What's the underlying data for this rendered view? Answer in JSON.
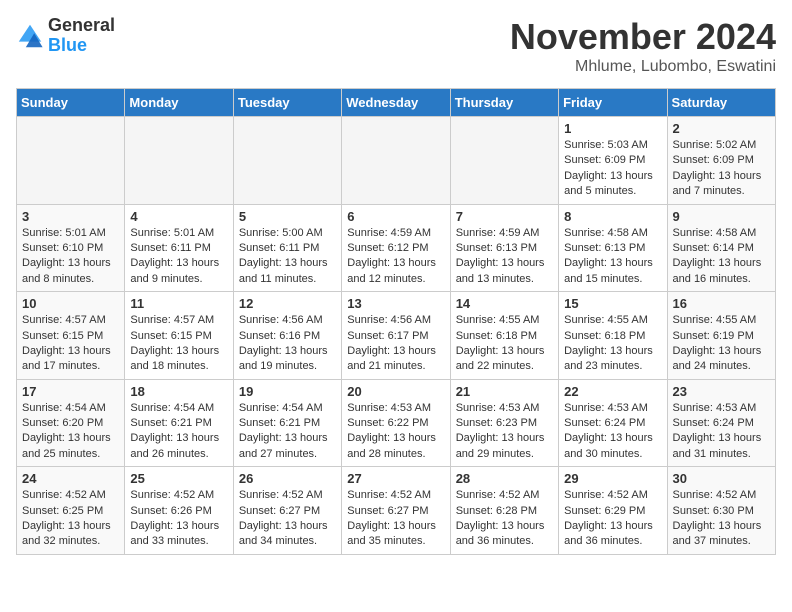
{
  "logo": {
    "general": "General",
    "blue": "Blue"
  },
  "title": "November 2024",
  "location": "Mhlume, Lubombo, Eswatini",
  "days_header": [
    "Sunday",
    "Monday",
    "Tuesday",
    "Wednesday",
    "Thursday",
    "Friday",
    "Saturday"
  ],
  "weeks": [
    [
      {
        "day": "",
        "info": ""
      },
      {
        "day": "",
        "info": ""
      },
      {
        "day": "",
        "info": ""
      },
      {
        "day": "",
        "info": ""
      },
      {
        "day": "",
        "info": ""
      },
      {
        "day": "1",
        "info": "Sunrise: 5:03 AM\nSunset: 6:09 PM\nDaylight: 13 hours\nand 5 minutes."
      },
      {
        "day": "2",
        "info": "Sunrise: 5:02 AM\nSunset: 6:09 PM\nDaylight: 13 hours\nand 7 minutes."
      }
    ],
    [
      {
        "day": "3",
        "info": "Sunrise: 5:01 AM\nSunset: 6:10 PM\nDaylight: 13 hours\nand 8 minutes."
      },
      {
        "day": "4",
        "info": "Sunrise: 5:01 AM\nSunset: 6:11 PM\nDaylight: 13 hours\nand 9 minutes."
      },
      {
        "day": "5",
        "info": "Sunrise: 5:00 AM\nSunset: 6:11 PM\nDaylight: 13 hours\nand 11 minutes."
      },
      {
        "day": "6",
        "info": "Sunrise: 4:59 AM\nSunset: 6:12 PM\nDaylight: 13 hours\nand 12 minutes."
      },
      {
        "day": "7",
        "info": "Sunrise: 4:59 AM\nSunset: 6:13 PM\nDaylight: 13 hours\nand 13 minutes."
      },
      {
        "day": "8",
        "info": "Sunrise: 4:58 AM\nSunset: 6:13 PM\nDaylight: 13 hours\nand 15 minutes."
      },
      {
        "day": "9",
        "info": "Sunrise: 4:58 AM\nSunset: 6:14 PM\nDaylight: 13 hours\nand 16 minutes."
      }
    ],
    [
      {
        "day": "10",
        "info": "Sunrise: 4:57 AM\nSunset: 6:15 PM\nDaylight: 13 hours\nand 17 minutes."
      },
      {
        "day": "11",
        "info": "Sunrise: 4:57 AM\nSunset: 6:15 PM\nDaylight: 13 hours\nand 18 minutes."
      },
      {
        "day": "12",
        "info": "Sunrise: 4:56 AM\nSunset: 6:16 PM\nDaylight: 13 hours\nand 19 minutes."
      },
      {
        "day": "13",
        "info": "Sunrise: 4:56 AM\nSunset: 6:17 PM\nDaylight: 13 hours\nand 21 minutes."
      },
      {
        "day": "14",
        "info": "Sunrise: 4:55 AM\nSunset: 6:18 PM\nDaylight: 13 hours\nand 22 minutes."
      },
      {
        "day": "15",
        "info": "Sunrise: 4:55 AM\nSunset: 6:18 PM\nDaylight: 13 hours\nand 23 minutes."
      },
      {
        "day": "16",
        "info": "Sunrise: 4:55 AM\nSunset: 6:19 PM\nDaylight: 13 hours\nand 24 minutes."
      }
    ],
    [
      {
        "day": "17",
        "info": "Sunrise: 4:54 AM\nSunset: 6:20 PM\nDaylight: 13 hours\nand 25 minutes."
      },
      {
        "day": "18",
        "info": "Sunrise: 4:54 AM\nSunset: 6:21 PM\nDaylight: 13 hours\nand 26 minutes."
      },
      {
        "day": "19",
        "info": "Sunrise: 4:54 AM\nSunset: 6:21 PM\nDaylight: 13 hours\nand 27 minutes."
      },
      {
        "day": "20",
        "info": "Sunrise: 4:53 AM\nSunset: 6:22 PM\nDaylight: 13 hours\nand 28 minutes."
      },
      {
        "day": "21",
        "info": "Sunrise: 4:53 AM\nSunset: 6:23 PM\nDaylight: 13 hours\nand 29 minutes."
      },
      {
        "day": "22",
        "info": "Sunrise: 4:53 AM\nSunset: 6:24 PM\nDaylight: 13 hours\nand 30 minutes."
      },
      {
        "day": "23",
        "info": "Sunrise: 4:53 AM\nSunset: 6:24 PM\nDaylight: 13 hours\nand 31 minutes."
      }
    ],
    [
      {
        "day": "24",
        "info": "Sunrise: 4:52 AM\nSunset: 6:25 PM\nDaylight: 13 hours\nand 32 minutes."
      },
      {
        "day": "25",
        "info": "Sunrise: 4:52 AM\nSunset: 6:26 PM\nDaylight: 13 hours\nand 33 minutes."
      },
      {
        "day": "26",
        "info": "Sunrise: 4:52 AM\nSunset: 6:27 PM\nDaylight: 13 hours\nand 34 minutes."
      },
      {
        "day": "27",
        "info": "Sunrise: 4:52 AM\nSunset: 6:27 PM\nDaylight: 13 hours\nand 35 minutes."
      },
      {
        "day": "28",
        "info": "Sunrise: 4:52 AM\nSunset: 6:28 PM\nDaylight: 13 hours\nand 36 minutes."
      },
      {
        "day": "29",
        "info": "Sunrise: 4:52 AM\nSunset: 6:29 PM\nDaylight: 13 hours\nand 36 minutes."
      },
      {
        "day": "30",
        "info": "Sunrise: 4:52 AM\nSunset: 6:30 PM\nDaylight: 13 hours\nand 37 minutes."
      }
    ]
  ]
}
